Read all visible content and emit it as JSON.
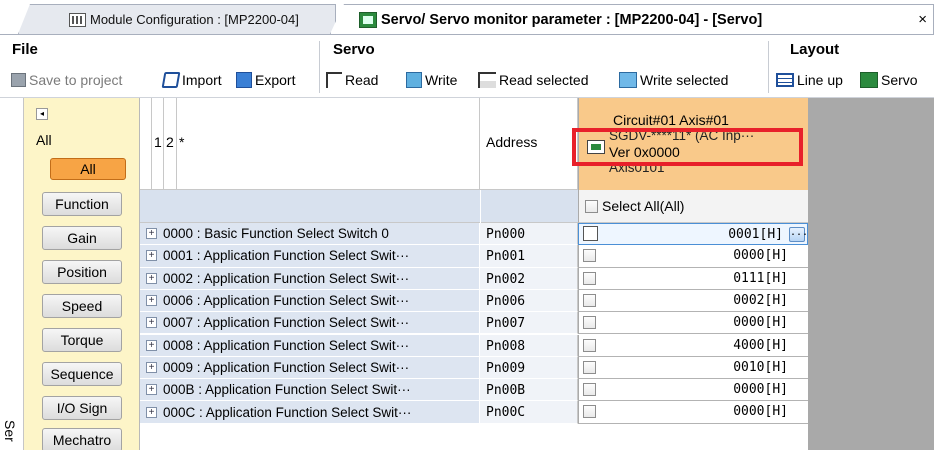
{
  "tabs": [
    {
      "label": "Module Configuration : [MP2200-04]",
      "icon": "module-config-icon",
      "active": false
    },
    {
      "label": "Servo/ Servo monitor parameter : [MP2200-04] - [Servo]",
      "icon": "servo-icon",
      "active": true,
      "close": "×"
    }
  ],
  "ribbon": {
    "file": {
      "title": "File",
      "save_label": "Save to project",
      "import_label": "Import",
      "export_label": "Export"
    },
    "servo": {
      "title": "Servo",
      "read_label": "Read",
      "write_label": "Write",
      "read_selected_label": "Read selected",
      "write_selected_label": "Write selected"
    },
    "layout": {
      "title": "Layout",
      "lineup_label": "Line up",
      "servo_label": "Servo"
    }
  },
  "left_strip": {
    "label": "Ser"
  },
  "categories": {
    "collapse": "◂",
    "header": "All",
    "selected": "All",
    "items": [
      "Function",
      "Gain",
      "Position",
      "Speed",
      "Torque",
      "Sequence",
      "I/O Sign",
      "Mechatro"
    ]
  },
  "grid": {
    "col1": "1",
    "col2": "2",
    "col_star": "*",
    "address_header": "Address",
    "axis": {
      "title": "Circuit#01 Axis#01",
      "model": "SGDV-****11* (AC Inp···",
      "version": "Ver 0x0000",
      "name": "Axis0101"
    },
    "select_all_label": "Select All(All)",
    "rows": [
      {
        "name": "0000 : Basic Function Select Switch 0",
        "address": "Pn000",
        "value": "0001[H]",
        "selected": true
      },
      {
        "name": "0001 : Application Function Select Swit···",
        "address": "Pn001",
        "value": "0000[H]"
      },
      {
        "name": "0002 : Application Function Select Swit···",
        "address": "Pn002",
        "value": "0111[H]"
      },
      {
        "name": "0006 : Application Function Select Swit···",
        "address": "Pn006",
        "value": "0002[H]"
      },
      {
        "name": "0007 : Application Function Select Swit···",
        "address": "Pn007",
        "value": "0000[H]"
      },
      {
        "name": "0008 : Application Function Select Swit···",
        "address": "Pn008",
        "value": "4000[H]"
      },
      {
        "name": "0009 : Application Function Select Swit···",
        "address": "Pn009",
        "value": "0010[H]"
      },
      {
        "name": "000B : Application Function Select Swit···",
        "address": "Pn00B",
        "value": "0000[H]"
      },
      {
        "name": "000C : Application Function Select Swit···",
        "address": "Pn00C",
        "value": "0000[H]"
      }
    ],
    "ellipsis_button": "..."
  },
  "colors": {
    "highlight": "#e8202a",
    "category_selected": "#f7a445",
    "axis_header": "#f9c98a",
    "category_panel": "#fdf5c8"
  }
}
